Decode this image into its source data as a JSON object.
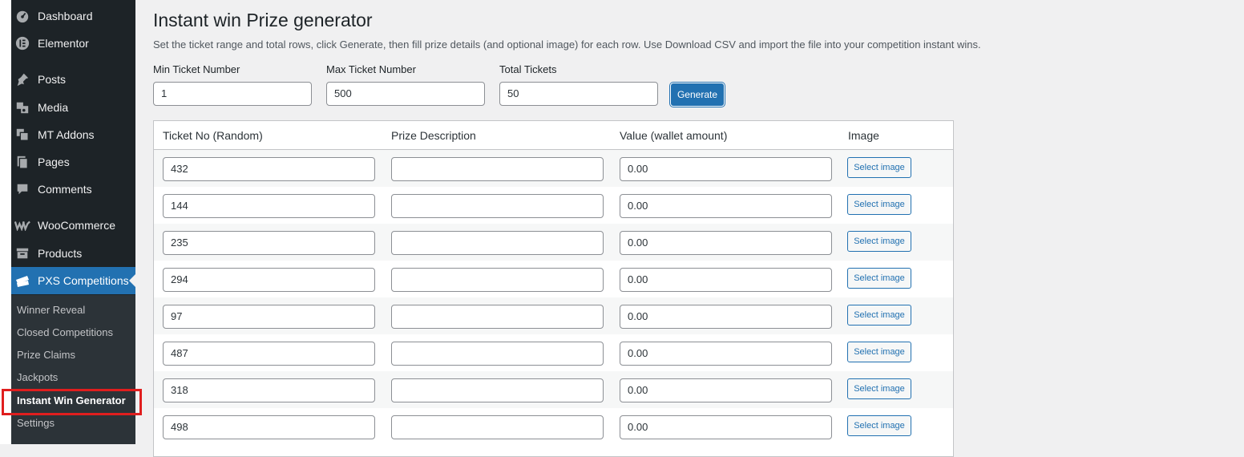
{
  "sidebar": {
    "items": [
      {
        "label": "Dashboard",
        "icon": "dashboard-icon"
      },
      {
        "label": "Elementor",
        "icon": "elementor-icon"
      },
      {
        "label": "Posts",
        "icon": "pin-icon"
      },
      {
        "label": "Media",
        "icon": "media-icon"
      },
      {
        "label": "MT Addons",
        "icon": "addons-icon"
      },
      {
        "label": "Pages",
        "icon": "pages-icon"
      },
      {
        "label": "Comments",
        "icon": "comment-icon"
      },
      {
        "label": "WooCommerce",
        "icon": "woocommerce-icon"
      },
      {
        "label": "Products",
        "icon": "archive-icon"
      },
      {
        "label": "PXS Competitions",
        "icon": "tickets-icon"
      }
    ],
    "submenu": [
      {
        "label": "Winner Reveal"
      },
      {
        "label": "Closed Competitions"
      },
      {
        "label": "Prize Claims"
      },
      {
        "label": "Jackpots"
      },
      {
        "label": "Instant Win Generator"
      },
      {
        "label": "Settings"
      }
    ]
  },
  "page": {
    "title": "Instant win Prize generator",
    "description": "Set the ticket range and total rows, click Generate, then fill prize details (and optional image) for each row. Use Download CSV and import the file into your competition instant wins."
  },
  "form": {
    "min_label": "Min Ticket Number",
    "min_value": "1",
    "max_label": "Max Ticket Number",
    "max_value": "500",
    "total_label": "Total Tickets",
    "total_value": "50",
    "generate_label": "Generate"
  },
  "table": {
    "headers": [
      "Ticket No (Random)",
      "Prize Description",
      "Value (wallet amount)",
      "Image"
    ],
    "select_image_label": "Select image",
    "rows": [
      {
        "ticket": "432",
        "prize": "",
        "value": "0.00"
      },
      {
        "ticket": "144",
        "prize": "",
        "value": "0.00"
      },
      {
        "ticket": "235",
        "prize": "",
        "value": "0.00"
      },
      {
        "ticket": "294",
        "prize": "",
        "value": "0.00"
      },
      {
        "ticket": "97",
        "prize": "",
        "value": "0.00"
      },
      {
        "ticket": "487",
        "prize": "",
        "value": "0.00"
      },
      {
        "ticket": "318",
        "prize": "",
        "value": "0.00"
      },
      {
        "ticket": "498",
        "prize": "",
        "value": "0.00"
      }
    ]
  },
  "colors": {
    "accent": "#2271b1",
    "sidebar_bg": "#1d2327",
    "submenu_bg": "#2c3338",
    "highlight": "#e01e1e"
  }
}
